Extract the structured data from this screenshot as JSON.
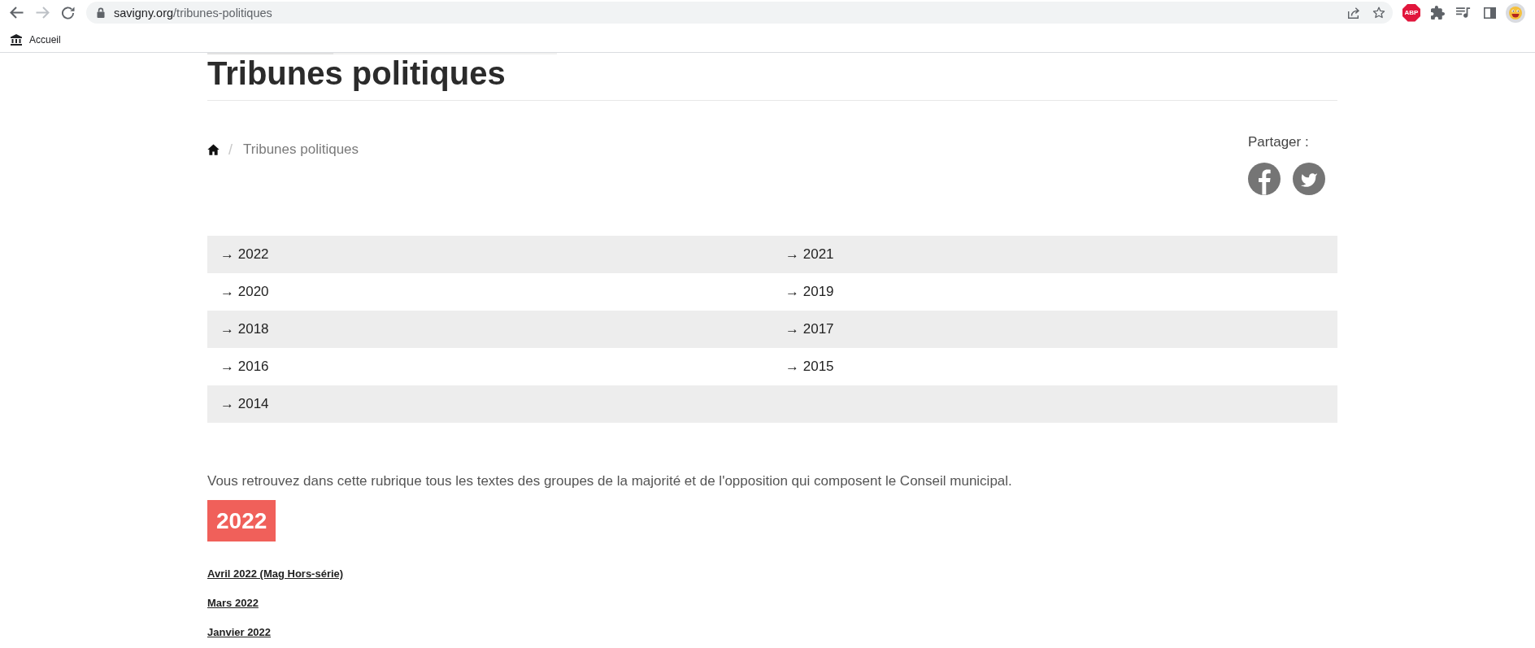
{
  "browser": {
    "nav_buttons": [
      {
        "kind": "back",
        "disabled": false
      },
      {
        "kind": "forward",
        "disabled": true
      },
      {
        "kind": "reload",
        "disabled": false
      }
    ],
    "address_bar": {
      "host": "savigny.org",
      "path": "/tribunes-politiques"
    },
    "address_actions": [
      {
        "kind": "share"
      },
      {
        "kind": "star"
      }
    ],
    "extensions": [
      {
        "kind": "abp",
        "label": "ABP"
      },
      {
        "kind": "puzzle"
      },
      {
        "kind": "media"
      },
      {
        "kind": "side_panel"
      },
      {
        "kind": "avatar"
      }
    ],
    "bookmarks": [
      {
        "label": "Accueil"
      }
    ]
  },
  "page": {
    "title": "Tribunes politiques",
    "breadcrumb": [
      {
        "kind": "home"
      },
      {
        "kind": "separator",
        "text": "/"
      },
      {
        "kind": "current",
        "text": "Tribunes politiques"
      }
    ],
    "share": {
      "label": "Partager :",
      "networks": [
        {
          "kind": "facebook"
        },
        {
          "kind": "twitter"
        }
      ]
    },
    "year_links": [
      "→ 2022",
      "→ 2021",
      "→ 2020",
      "→ 2019",
      "→ 2018",
      "→ 2017",
      "→ 2016",
      "→ 2015",
      "→ 2014"
    ],
    "intro": "Vous retrouvez dans cette rubrique tous les textes des groupes de la majorité et de l'opposition qui composent le Conseil municipal.",
    "section_heading": "2022",
    "month_links": [
      "Avril 2022 (Mag Hors-série)",
      "Mars 2022",
      "Janvier 2022"
    ]
  }
}
